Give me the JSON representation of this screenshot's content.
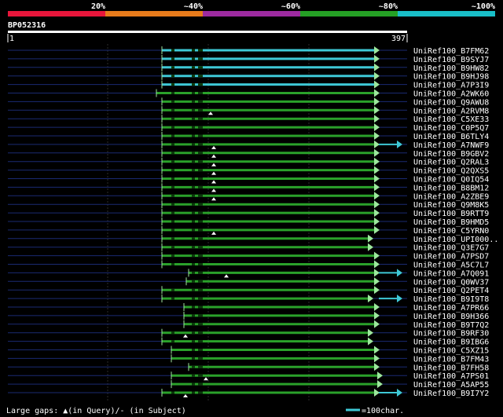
{
  "scale": {
    "labels": [
      "20%",
      "~40%",
      "~60%",
      "~80%",
      "~100%"
    ],
    "colors": [
      "#e8163b",
      "#e87b1b",
      "#9d2ba0",
      "#25a025",
      "#19bec8"
    ]
  },
  "query": {
    "id": "BP052316",
    "start": "1",
    "end": "397"
  },
  "colors": {
    "hit_line": "#2aa12a",
    "hit_line_top": "#3ec8d6",
    "backbone": "#1a2a72",
    "arrow": "#3ec8d6",
    "gap_marker": "#ffffff"
  },
  "legend": {
    "gaps_text": "Large gaps: ▲(in Query)/- (in Subject)",
    "scale_text": "=100char."
  },
  "hits": [
    {
      "name": "UniRef100_B7FM62",
      "color": "cyan"
    },
    {
      "name": "UniRef100_B9SYJ7",
      "color": "cyan"
    },
    {
      "name": "UniRef100_B9HW82",
      "color": "cyan"
    },
    {
      "name": "UniRef100_B9HJ98",
      "color": "cyan"
    },
    {
      "name": "UniRef100_A7P3I9",
      "color": "cyan"
    },
    {
      "name": "UniRef100_A2WK60",
      "color": "green"
    },
    {
      "name": "UniRef100_Q9AWU8",
      "color": "green"
    },
    {
      "name": "UniRef100_A2RVM8",
      "color": "green"
    },
    {
      "name": "UniRef100_C5XE33",
      "color": "green"
    },
    {
      "name": "UniRef100_C0P5Q7",
      "color": "green"
    },
    {
      "name": "UniRef100_B6TLY4",
      "color": "green"
    },
    {
      "name": "UniRef100_A7NWF9",
      "color": "green",
      "ext": true
    },
    {
      "name": "UniRef100_B9GBV2",
      "color": "green"
    },
    {
      "name": "UniRef100_Q2RAL3",
      "color": "green"
    },
    {
      "name": "UniRef100_Q2QXS5",
      "color": "green"
    },
    {
      "name": "UniRef100_Q0IQ54",
      "color": "green"
    },
    {
      "name": "UniRef100_B8BM12",
      "color": "green"
    },
    {
      "name": "UniRef100_A2ZBE9",
      "color": "green"
    },
    {
      "name": "UniRef100_Q9M8K5",
      "color": "green"
    },
    {
      "name": "UniRef100_B9RTT9",
      "color": "green"
    },
    {
      "name": "UniRef100_B9HMD5",
      "color": "green"
    },
    {
      "name": "UniRef100_C5YRN0",
      "color": "green"
    },
    {
      "name": "UniRef100_UPI000..",
      "color": "green"
    },
    {
      "name": "UniRef100_Q3E7G7",
      "color": "green"
    },
    {
      "name": "UniRef100_A7PSD7",
      "color": "green"
    },
    {
      "name": "UniRef100_A5C7L7",
      "color": "green"
    },
    {
      "name": "UniRef100_A7Q091",
      "color": "green",
      "ext": true
    },
    {
      "name": "UniRef100_Q0WV37",
      "color": "green"
    },
    {
      "name": "UniRef100_Q2PET4",
      "color": "green"
    },
    {
      "name": "UniRef100_B9I9T8",
      "color": "green",
      "ext": true
    },
    {
      "name": "UniRef100_A7PR66",
      "color": "green"
    },
    {
      "name": "UniRef100_B9H366",
      "color": "green"
    },
    {
      "name": "UniRef100_B9T7Q2",
      "color": "green"
    },
    {
      "name": "UniRef100_B9RF30",
      "color": "green"
    },
    {
      "name": "UniRef100_B9IBG6",
      "color": "green"
    },
    {
      "name": "UniRef100_C5XZ15",
      "color": "green"
    },
    {
      "name": "UniRef100_B7FM43",
      "color": "green"
    },
    {
      "name": "UniRef100_B7FH58",
      "color": "green"
    },
    {
      "name": "UniRef100_A7PS01",
      "color": "green"
    },
    {
      "name": "UniRef100_A5AP55",
      "color": "green"
    },
    {
      "name": "UniRef100_B9I7Y2",
      "color": "green",
      "ext": true
    }
  ]
}
